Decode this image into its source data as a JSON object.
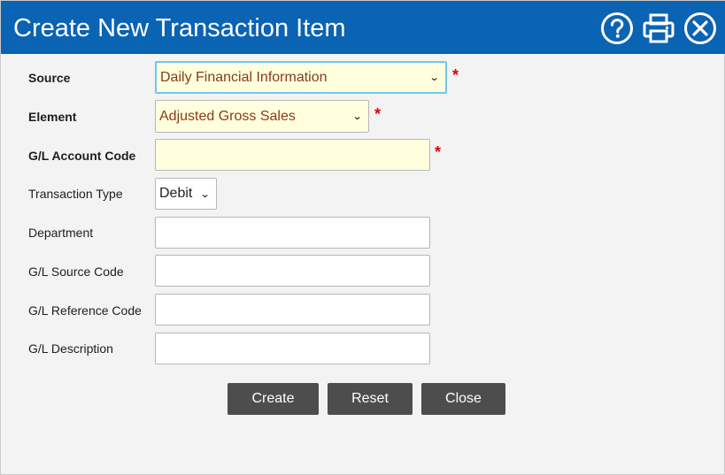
{
  "dialog": {
    "title": "Create New Transaction Item",
    "icons": [
      "help-icon",
      "print-icon",
      "close-icon"
    ],
    "header_color": "#0b63b3"
  },
  "form": {
    "source": {
      "label": "Source",
      "value": "Daily Financial Information",
      "required_mark": "*"
    },
    "element": {
      "label": "Element",
      "value": "Adjusted Gross Sales",
      "required_mark": "*"
    },
    "gl_account_code": {
      "label": "G/L Account Code",
      "value": "",
      "required_mark": "*"
    },
    "transaction_type": {
      "label": "Transaction Type",
      "value": "Debit"
    },
    "department": {
      "label": "Department",
      "value": ""
    },
    "gl_source_code": {
      "label": "G/L Source Code",
      "value": ""
    },
    "gl_reference_code": {
      "label": "G/L Reference Code",
      "value": ""
    },
    "gl_description": {
      "label": "G/L Description",
      "value": ""
    }
  },
  "buttons": {
    "create": "Create",
    "reset": "Reset",
    "close": "Close"
  }
}
